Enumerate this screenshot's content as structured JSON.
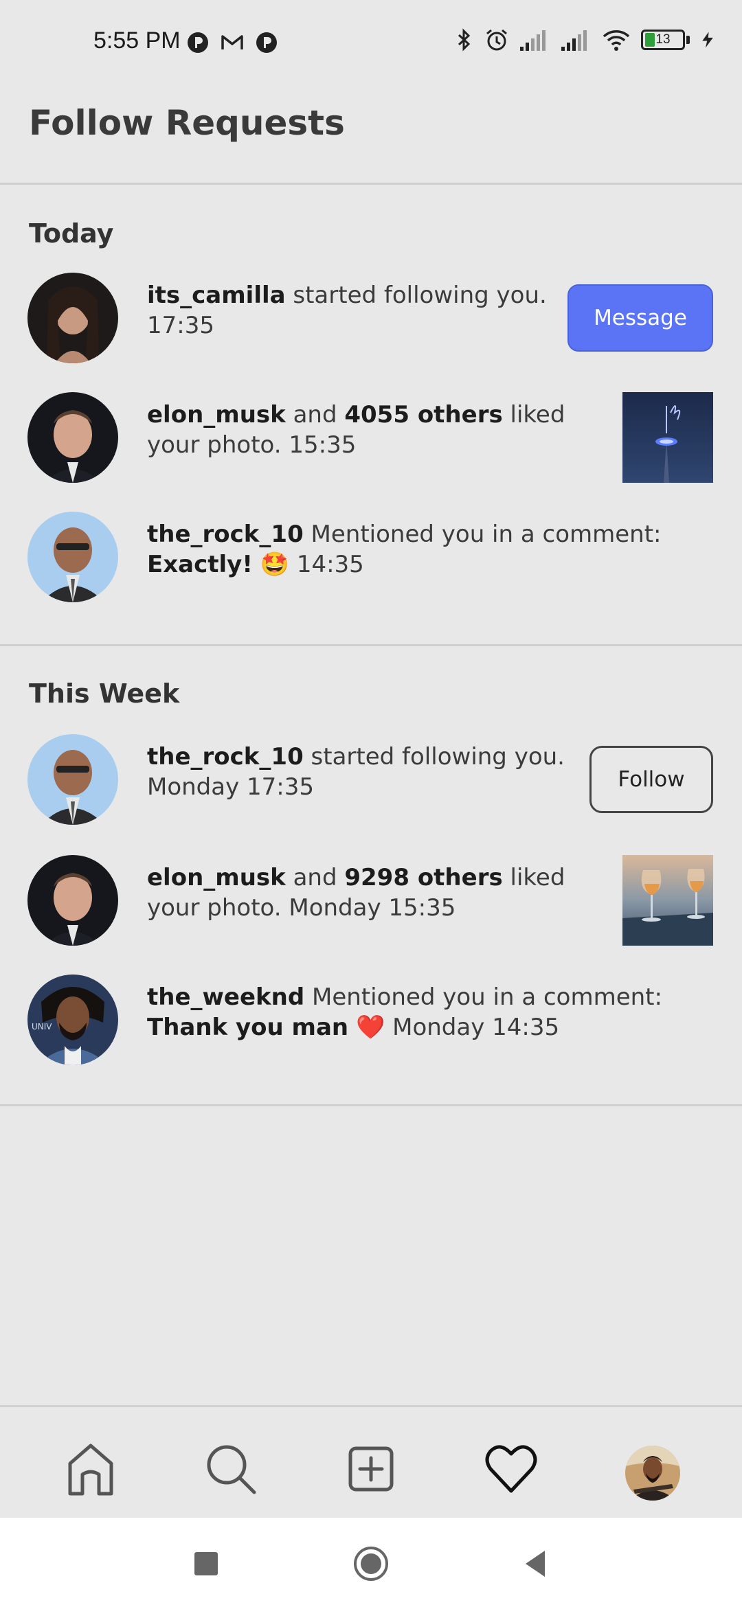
{
  "status_bar": {
    "time": "5:55 PM",
    "battery": "13",
    "left_icons": [
      "circle-p-icon",
      "gmail-icon",
      "circle-p-icon"
    ],
    "right_icons": [
      "bluetooth-icon",
      "alarm-icon",
      "signal-icon",
      "signal-icon",
      "wifi-icon",
      "battery-icon",
      "charging-icon"
    ]
  },
  "header": {
    "title": "Follow Requests"
  },
  "sections": [
    {
      "title": "Today",
      "items": [
        {
          "user": "its_camilla",
          "text": " started following you.",
          "time": "17:35",
          "action": "Message"
        },
        {
          "user": "elon_musk",
          "mid": " and ",
          "count": "4055 others",
          "text": " liked your photo.",
          "time": "15:35"
        },
        {
          "user": "the_rock_10",
          "text": " Mentioned you in a comment:",
          "comment": "Exactly!",
          "emoji": "🤩",
          "time": "14:35"
        }
      ]
    },
    {
      "title": "This Week",
      "items": [
        {
          "user": "the_rock_10",
          "text": " started following you.",
          "time": "Monday 17:35",
          "action": "Follow"
        },
        {
          "user": "elon_musk",
          "mid": " and ",
          "count": "9298 others",
          "text": " liked your photo.",
          "time": "Monday 15:35"
        },
        {
          "user": "the_weeknd",
          "text": " Mentioned you in a comment:",
          "comment": "Thank you man",
          "emoji": "❤️",
          "time": "Monday 14:35"
        }
      ]
    }
  ],
  "bottom_nav": [
    "home-icon",
    "search-icon",
    "add-post-icon",
    "heart-icon",
    "profile-avatar"
  ],
  "system_nav": [
    "recents-icon",
    "home-circle-icon",
    "back-icon"
  ],
  "colors": {
    "accent": "#5b74f6",
    "background": "#e8e8e8"
  }
}
